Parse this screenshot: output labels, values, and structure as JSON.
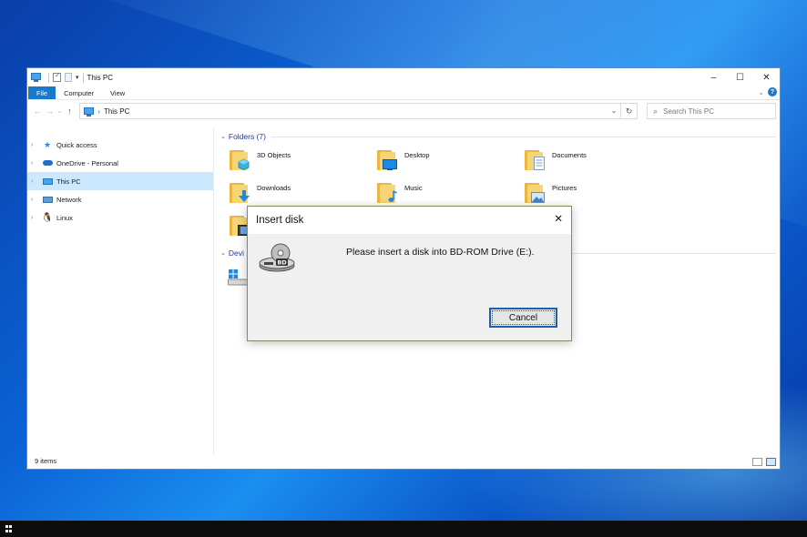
{
  "window": {
    "title": "This PC",
    "controls": {
      "minimize": "–",
      "maximize": "☐",
      "close": "✕"
    }
  },
  "ribbon": {
    "tabs": [
      "File",
      "Computer",
      "View"
    ],
    "help": "?"
  },
  "address": {
    "path": "This PC",
    "search_placeholder": "Search This PC"
  },
  "sidebar": {
    "items": [
      {
        "label": "Quick access",
        "icon": "star-icon"
      },
      {
        "label": "OneDrive - Personal",
        "icon": "cloud-icon"
      },
      {
        "label": "This PC",
        "icon": "computer-icon",
        "selected": true
      },
      {
        "label": "Network",
        "icon": "network-icon"
      },
      {
        "label": "Linux",
        "icon": "linux-icon"
      }
    ]
  },
  "folders": {
    "header": "Folders (7)",
    "items": [
      {
        "name": "3D Objects",
        "icon": "3d-objects-folder-icon"
      },
      {
        "name": "Desktop",
        "icon": "desktop-folder-icon"
      },
      {
        "name": "Documents",
        "icon": "documents-folder-icon"
      },
      {
        "name": "Downloads",
        "icon": "downloads-folder-icon"
      },
      {
        "name": "Music",
        "icon": "music-folder-icon"
      },
      {
        "name": "Pictures",
        "icon": "pictures-folder-icon"
      },
      {
        "name": "",
        "icon": "videos-folder-icon"
      }
    ]
  },
  "devices": {
    "header_visible": "Devi"
  },
  "status": {
    "items_count": "9 items"
  },
  "dialog": {
    "title": "Insert disk",
    "message": "Please insert a disk into BD-ROM Drive (E:).",
    "cancel_label": "Cancel",
    "close": "✕",
    "icon": "bd-drive-icon",
    "icon_label": "BD"
  },
  "colors": {
    "accent": "#1979ca",
    "selection": "#cce8ff",
    "group_header": "#1e3d8f"
  }
}
